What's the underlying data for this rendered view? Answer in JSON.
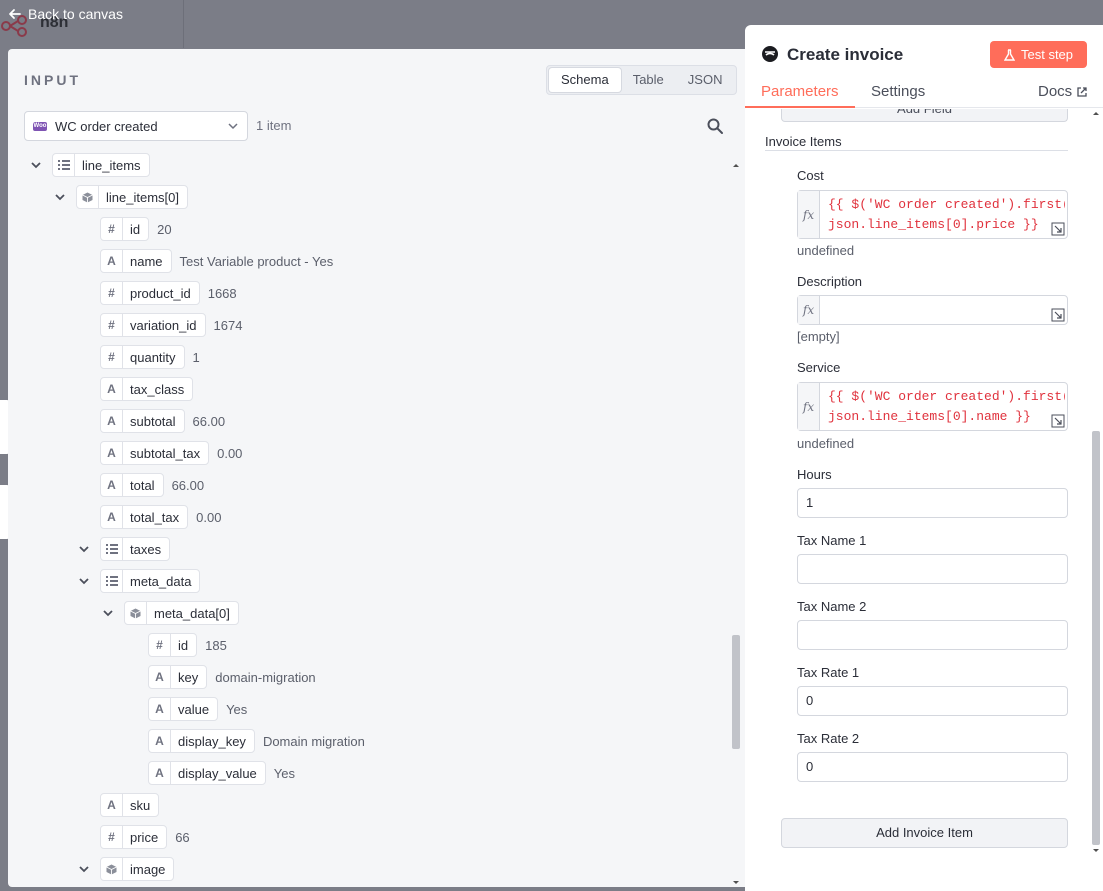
{
  "app": {
    "logo_text": "n8n",
    "back_label": "Back to canvas"
  },
  "input_panel": {
    "title": "INPUT",
    "views": [
      {
        "label": "Schema",
        "active": true
      },
      {
        "label": "Table",
        "active": false
      },
      {
        "label": "JSON",
        "active": false
      }
    ],
    "node_select": {
      "badge": "Woo",
      "value": "WC order created"
    },
    "item_count": "1 item",
    "tree": [
      {
        "key": "line_items",
        "type": "list",
        "level": 0,
        "expanded": true,
        "value": ""
      },
      {
        "key": "line_items[0]",
        "type": "object",
        "level": 1,
        "expanded": true,
        "value": ""
      },
      {
        "key": "id",
        "type": "number",
        "level": 2,
        "value": "20"
      },
      {
        "key": "name",
        "type": "string",
        "level": 2,
        "value": "Test Variable product - Yes"
      },
      {
        "key": "product_id",
        "type": "number",
        "level": 2,
        "value": "1668"
      },
      {
        "key": "variation_id",
        "type": "number",
        "level": 2,
        "value": "1674"
      },
      {
        "key": "quantity",
        "type": "number",
        "level": 2,
        "value": "1"
      },
      {
        "key": "tax_class",
        "type": "string",
        "level": 2,
        "value": ""
      },
      {
        "key": "subtotal",
        "type": "string",
        "level": 2,
        "value": "66.00"
      },
      {
        "key": "subtotal_tax",
        "type": "string",
        "level": 2,
        "value": "0.00"
      },
      {
        "key": "total",
        "type": "string",
        "level": 2,
        "value": "66.00"
      },
      {
        "key": "total_tax",
        "type": "string",
        "level": 2,
        "value": "0.00"
      },
      {
        "key": "taxes",
        "type": "list",
        "level": 2,
        "expanded": true,
        "value": ""
      },
      {
        "key": "meta_data",
        "type": "list",
        "level": 2,
        "expanded": true,
        "value": ""
      },
      {
        "key": "meta_data[0]",
        "type": "object",
        "level": 3,
        "expanded": true,
        "value": ""
      },
      {
        "key": "id",
        "type": "number",
        "level": 4,
        "value": "185"
      },
      {
        "key": "key",
        "type": "string",
        "level": 4,
        "value": "domain-migration"
      },
      {
        "key": "value",
        "type": "string",
        "level": 4,
        "value": "Yes"
      },
      {
        "key": "display_key",
        "type": "string",
        "level": 4,
        "value": "Domain migration"
      },
      {
        "key": "display_value",
        "type": "string",
        "level": 4,
        "value": "Yes"
      },
      {
        "key": "sku",
        "type": "string",
        "level": 2,
        "value": ""
      },
      {
        "key": "price",
        "type": "number",
        "level": 2,
        "value": "66"
      },
      {
        "key": "image",
        "type": "object",
        "level": 2,
        "expanded": true,
        "value": ""
      }
    ]
  },
  "param_panel": {
    "title": "Create invoice",
    "test_label": "Test step",
    "tabs": [
      {
        "label": "Parameters",
        "active": true
      },
      {
        "label": "Settings",
        "active": false
      }
    ],
    "docs_label": "Docs",
    "add_field_label": "Add Field",
    "section_title": "Invoice Items",
    "fields": {
      "cost": {
        "label": "Cost",
        "expression_lines": [
          "{{ $('WC order created').first().",
          "json.line_items[0].price }}"
        ],
        "hint": "undefined"
      },
      "description": {
        "label": "Description",
        "expression_lines": [
          ""
        ],
        "hint": "[empty]"
      },
      "service": {
        "label": "Service",
        "expression_lines": [
          "{{ $('WC order created').first().",
          "json.line_items[0].name }}"
        ],
        "hint": "undefined"
      },
      "hours": {
        "label": "Hours",
        "value": "1"
      },
      "tax_name_1": {
        "label": "Tax Name 1",
        "value": ""
      },
      "tax_name_2": {
        "label": "Tax Name 2",
        "value": ""
      },
      "tax_rate_1": {
        "label": "Tax Rate 1",
        "value": "0"
      },
      "tax_rate_2": {
        "label": "Tax Rate 2",
        "value": "0"
      }
    },
    "add_item_label": "Add Invoice Item"
  }
}
